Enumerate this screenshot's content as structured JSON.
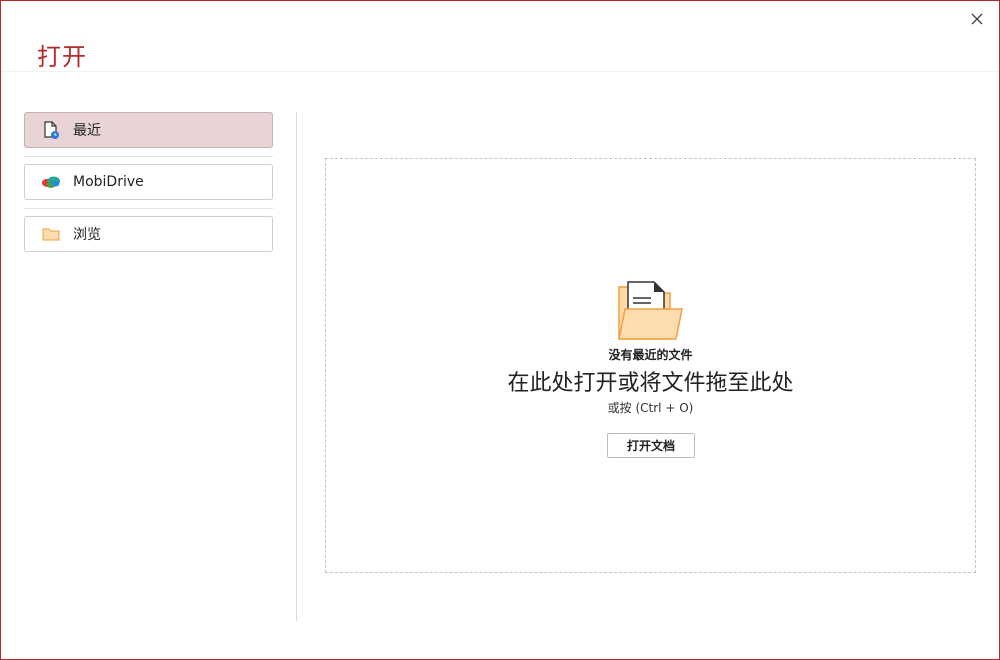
{
  "dialog": {
    "title": "打开"
  },
  "sidebar": {
    "items": [
      {
        "label": "最近",
        "icon": "recent-file-icon",
        "active": true
      },
      {
        "label": "MobiDrive",
        "icon": "mobidrive-icon",
        "active": false
      },
      {
        "label": "浏览",
        "icon": "folder-icon",
        "active": false
      }
    ]
  },
  "main": {
    "empty_title": "没有最近的文件",
    "drop_text": "在此处打开或将文件拖至此处",
    "shortcut_text": "或按 (Ctrl + O)",
    "open_button_label": "打开文档",
    "illustration": "empty-folder-icon"
  },
  "colors": {
    "accent": "#b52a2a",
    "active_item_bg": "#e8d4d4",
    "folder_fill": "#fdd9a8",
    "folder_stroke": "#f0a040"
  }
}
